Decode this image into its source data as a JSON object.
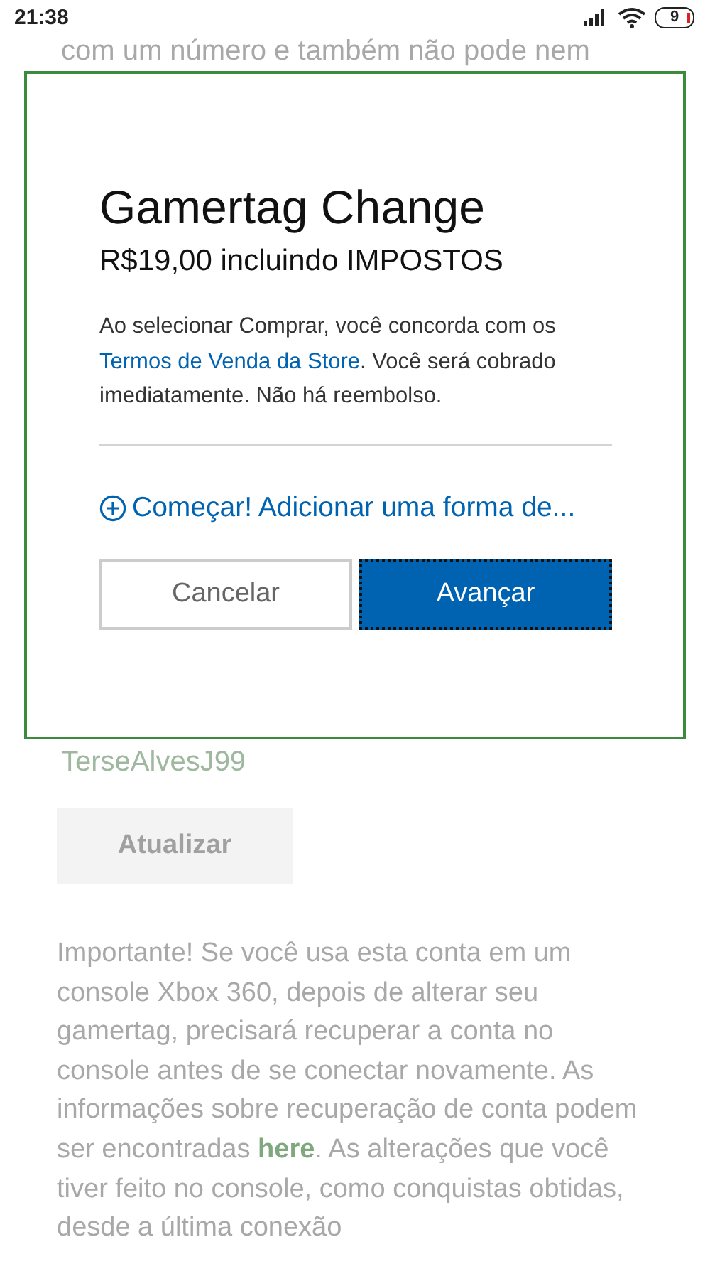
{
  "status_bar": {
    "time": "21:38",
    "battery": "9"
  },
  "background": {
    "cut_line": "com um número e também não pode nem",
    "gamertag": "TerseAlvesJ99",
    "update_button": {
      "label": "Atualizar",
      "disabled": true
    },
    "note": {
      "before": "Importante! Se você usa esta conta em um console Xbox 360, depois de alterar seu gamertag, precisará recuperar a conta no console antes de se conectar novamente. As informações sobre recuperação de conta podem ser encontradas ",
      "link": "here",
      "after": ". As alterações que você tiver feito no console, como conquistas obtidas, desde a última conexão"
    }
  },
  "dialog": {
    "title": "Gamertag Change",
    "price": "R$19,00 incluindo IMPOSTOS",
    "terms": {
      "before": "Ao selecionar Comprar, você concorda com os ",
      "link": "Termos de Venda da Store",
      "after": ". Você será cobrado imediatamente. Não há reembolso."
    },
    "add_payment": "Começar! Adicionar uma forma de...",
    "buttons": [
      {
        "label": "Cancelar",
        "kind": "secondary",
        "focused": false
      },
      {
        "label": "Avançar",
        "kind": "primary",
        "focused": true
      }
    ]
  }
}
